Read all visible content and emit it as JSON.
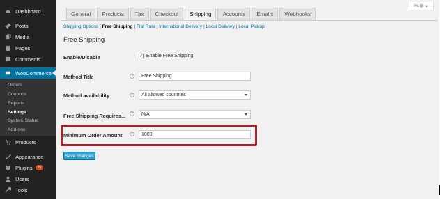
{
  "sidebar": {
    "items": [
      {
        "label": "Dashboard",
        "icon": "dashboard-icon"
      },
      {
        "label": "Posts",
        "icon": "pin-icon"
      },
      {
        "label": "Media",
        "icon": "media-icon"
      },
      {
        "label": "Pages",
        "icon": "pages-icon"
      },
      {
        "label": "Comments",
        "icon": "comment-icon"
      },
      {
        "label": "WooCommerce",
        "icon": "woocommerce-icon"
      },
      {
        "label": "Products",
        "icon": "cart-icon"
      },
      {
        "label": "Appearance",
        "icon": "brush-icon"
      },
      {
        "label": "Plugins",
        "icon": "plugin-icon",
        "badge": "25"
      },
      {
        "label": "Users",
        "icon": "users-icon"
      },
      {
        "label": "Tools",
        "icon": "wrench-icon"
      }
    ],
    "woocommerce_submenu": [
      "Orders",
      "Coupons",
      "Reports",
      "Settings",
      "System Status",
      "Add-ons"
    ],
    "current_submenu": "Settings"
  },
  "help_tab": {
    "label": "Help",
    "icon": "caret-down-icon"
  },
  "tabs": [
    "General",
    "Products",
    "Tax",
    "Checkout",
    "Shipping",
    "Accounts",
    "Emails",
    "Webhooks"
  ],
  "active_tab": "Shipping",
  "subsections": [
    "Shipping Options",
    "Free Shipping",
    "Flat Rate",
    "International Delivery",
    "Local Delivery",
    "Local Pickup"
  ],
  "current_subsection": "Free Shipping",
  "section_title": "Free Shipping",
  "form": {
    "enable": {
      "label": "Enable/Disable",
      "checkbox_label": "Enable Free Shipping",
      "checked": true
    },
    "method_title": {
      "label": "Method Title",
      "value": "Free Shipping"
    },
    "availability": {
      "label": "Method availability",
      "value": "All allowed countries"
    },
    "requires": {
      "label": "Free Shipping Requires...",
      "value": "N/A"
    },
    "min_amount": {
      "label": "Minimum Order Amount",
      "value": "1000"
    }
  },
  "save_button": "Save changes",
  "colors": {
    "sidebar_bg": "#222222",
    "active_menu": "#0074a2",
    "link": "#0074a2",
    "button": "#2ea2cc",
    "highlight": "#a8242b",
    "badge": "#d54e21"
  }
}
